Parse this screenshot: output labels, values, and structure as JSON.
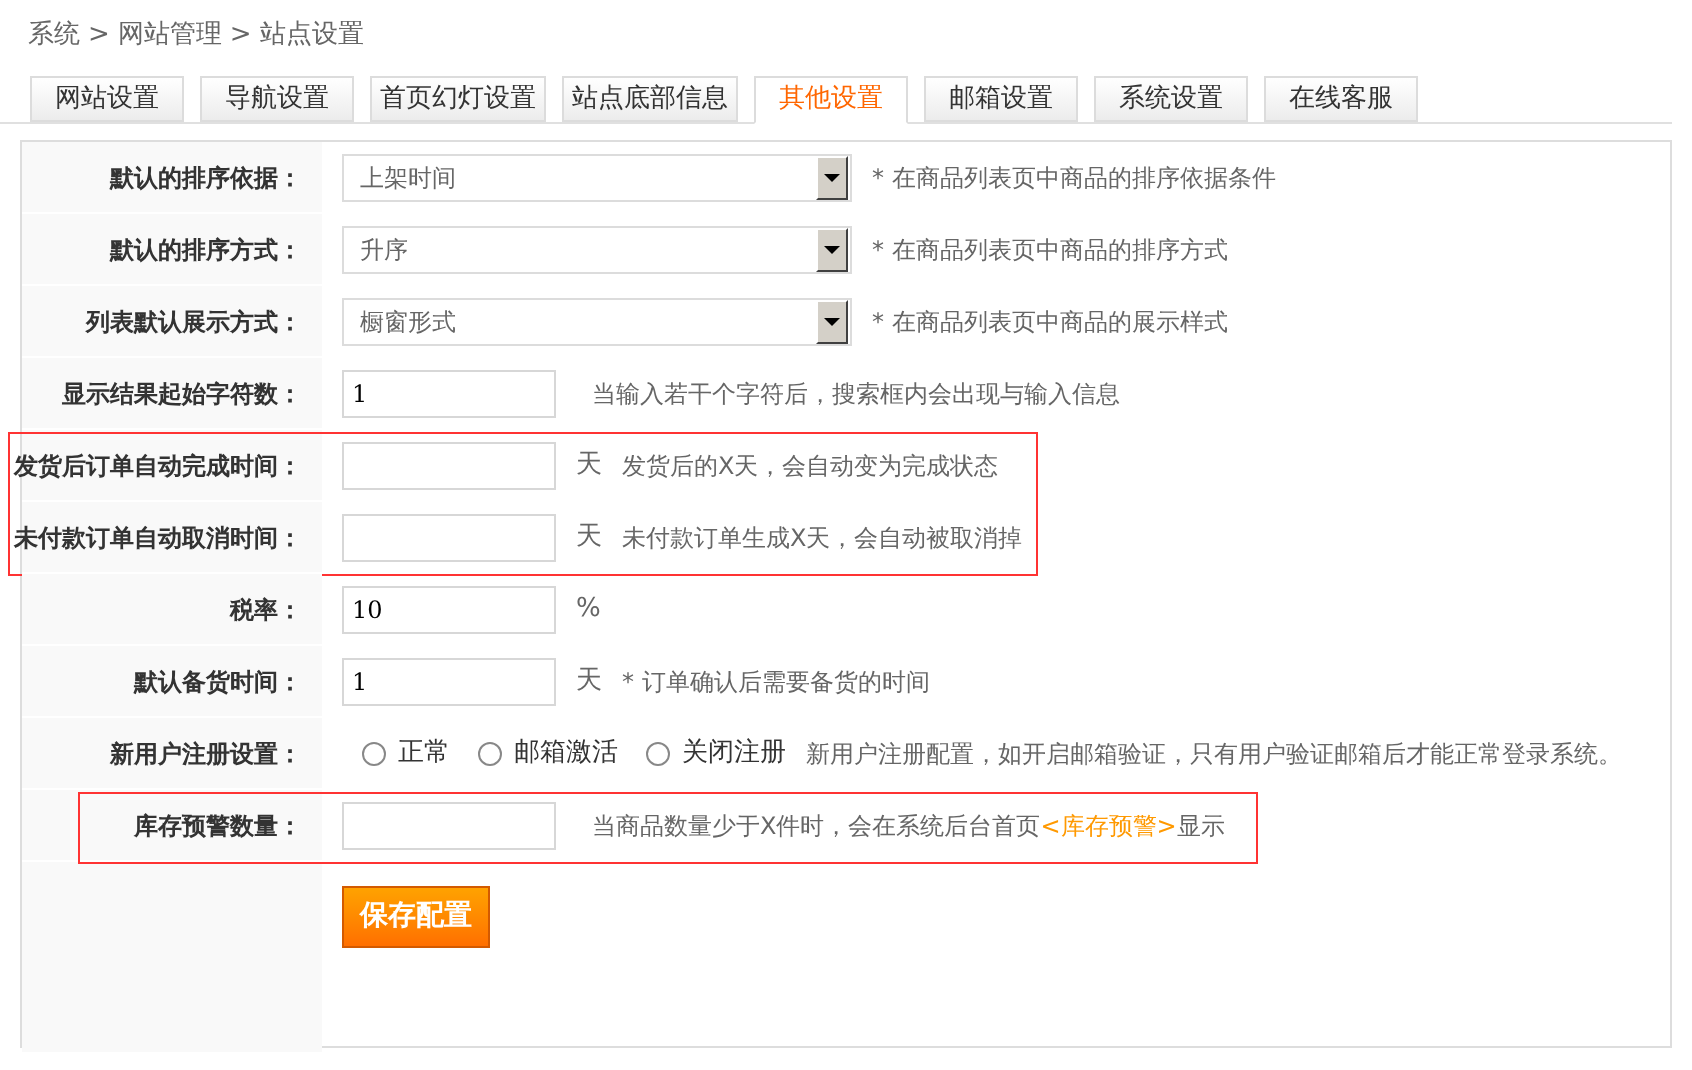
{
  "breadcrumb": [
    "系统",
    "网站管理",
    "站点设置"
  ],
  "breadcrumb_separator": ">",
  "tabs": [
    {
      "label": "网站设置",
      "selected": false
    },
    {
      "label": "导航设置",
      "selected": false
    },
    {
      "label": "首页幻灯设置",
      "selected": false
    },
    {
      "label": "站点底部信息",
      "selected": false
    },
    {
      "label": "其他设置",
      "selected": true
    },
    {
      "label": "邮箱设置",
      "selected": false
    },
    {
      "label": "系统设置",
      "selected": false
    },
    {
      "label": "在线客服",
      "selected": false
    }
  ],
  "sections": [
    {
      "highlighted": false,
      "rows": [
        {
          "kind": "select",
          "label": "默认的排序依据：",
          "value": "上架时间",
          "note": "* 在商品列表页中商品的排序依据条件"
        },
        {
          "kind": "select",
          "label": "默认的排序方式：",
          "value": "升序",
          "note": "* 在商品列表页中商品的排序方式"
        },
        {
          "kind": "select",
          "label": "列表默认展示方式：",
          "value": "橱窗形式",
          "note": "* 在商品列表页中商品的展示样式"
        },
        {
          "kind": "input",
          "label": "显示结果起始字符数：",
          "value": "1",
          "note": "当输入若干个字符后，搜索框内会出现与输入信息"
        }
      ]
    },
    {
      "highlighted": true,
      "rows": [
        {
          "kind": "input",
          "label": "发货后订单自动完成时间：",
          "value": "",
          "unit": "天",
          "note": "发货后的X天，会自动变为完成状态"
        },
        {
          "kind": "input",
          "label": "未付款订单自动取消时间：",
          "value": "",
          "unit": "天",
          "note": "未付款订单生成X天，会自动被取消掉"
        }
      ]
    },
    {
      "highlighted": false,
      "rows": [
        {
          "kind": "input",
          "label": "税率：",
          "value": "10",
          "unit": "%"
        },
        {
          "kind": "input",
          "label": "默认备货时间：",
          "value": "1",
          "unit": "天",
          "note": "* 订单确认后需要备货的时间"
        },
        {
          "kind": "radio",
          "label": "新用户注册设置：",
          "options": [
            {
              "label": "正常",
              "selected": false
            },
            {
              "label": "邮箱激活",
              "selected": false
            },
            {
              "label": "关闭注册",
              "selected": false
            }
          ],
          "note": "新用户注册配置，如开启邮箱验证，只有用户验证邮箱后才能正常登录系统。"
        }
      ]
    },
    {
      "highlighted": true,
      "rows": [
        {
          "kind": "input",
          "label": "库存预警数量：",
          "value": "",
          "note": "当商品数量少于X件时，会在系统后台首页",
          "note_emphasis": "<库存预警>",
          "note_after": "显示"
        }
      ]
    }
  ],
  "save_button": "保存配置"
}
